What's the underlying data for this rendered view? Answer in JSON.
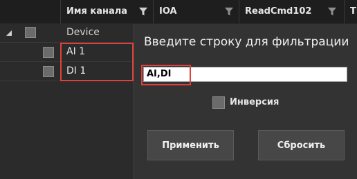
{
  "header": {
    "col_channel": "Имя канала",
    "col_ioa": "IOA",
    "col_readcmd": "ReadCmd102",
    "col_partial": "Ти"
  },
  "tree": {
    "root_label": "Device",
    "items": [
      {
        "label": "AI 1"
      },
      {
        "label": "DI 1"
      }
    ]
  },
  "filter_popup": {
    "title": "Введите строку для фильтрации",
    "input_value": "AI,DI",
    "inversion_label": "Инверсия",
    "apply_label": "Применить",
    "reset_label": "Сбросить"
  },
  "colors": {
    "highlight": "#e0403c",
    "background": "#2b2b2b",
    "header": "#1e1e1e"
  }
}
